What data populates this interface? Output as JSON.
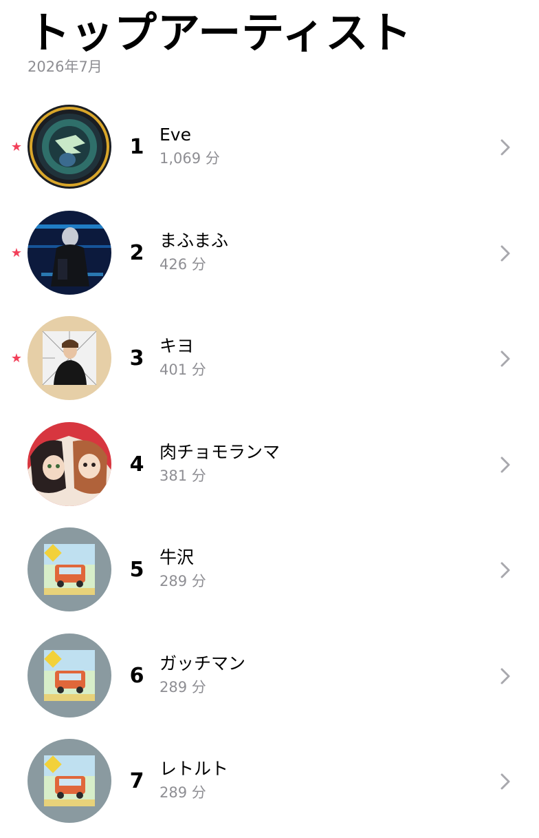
{
  "header": {
    "title": "トップアーティスト",
    "subtitle": "2026年7月"
  },
  "colors": {
    "star": "#f2405a",
    "secondary_text": "#8e8e93",
    "chevron": "#a8a8ad"
  },
  "artists": [
    {
      "rank": "1",
      "name": "Eve",
      "minutes": "1,069 分",
      "starred": true,
      "avatar": "dark-circular-artwork"
    },
    {
      "rank": "2",
      "name": "まふまふ",
      "minutes": "426 分",
      "starred": true,
      "avatar": "blue-neon-portrait"
    },
    {
      "rank": "3",
      "name": "キヨ",
      "minutes": "401 分",
      "starred": true,
      "avatar": "beige-manga-portrait"
    },
    {
      "rank": "4",
      "name": "肉チョモランマ",
      "minutes": "381 分",
      "starred": false,
      "avatar": "anime-duo-illustration"
    },
    {
      "rank": "5",
      "name": "牛沢",
      "minutes": "289 分",
      "starred": false,
      "avatar": "four-man-cell-album-art"
    },
    {
      "rank": "6",
      "name": "ガッチマン",
      "minutes": "289 分",
      "starred": false,
      "avatar": "four-man-cell-album-art"
    },
    {
      "rank": "7",
      "name": "レトルト",
      "minutes": "289 分",
      "starred": false,
      "avatar": "four-man-cell-album-art"
    }
  ]
}
